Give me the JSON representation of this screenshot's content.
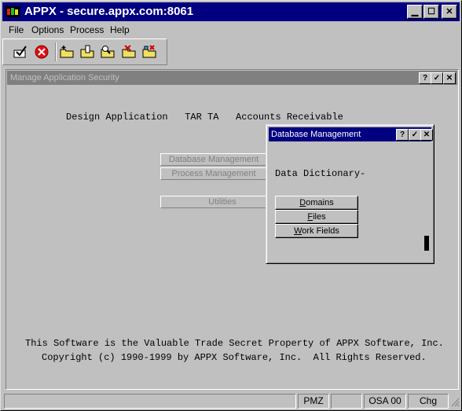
{
  "window": {
    "title": "APPX - secure.appx.com:8061",
    "controls": [
      "minimize",
      "maximize",
      "close"
    ]
  },
  "menu": [
    "File",
    "Options",
    "Process",
    "Help"
  ],
  "toolbar": {
    "icons": [
      "ok-check-icon",
      "cancel-icon",
      "folder-add-icon",
      "folder-edit-icon",
      "folder-search-icon",
      "folder-delete-icon",
      "folder-tools-icon"
    ]
  },
  "mdi": {
    "title": "Manage Application Security",
    "header_line": "Design Application   TAR TA   Accounts Receivable",
    "buttons": [
      "Database Management",
      "Process Management",
      "Utilities"
    ],
    "footer_line1": "This Software is the Valuable Trade Secret Property of APPX Software, Inc.",
    "footer_line2": "Copyright (c) 1990-1999 by APPX Software, Inc.  All Rights Reserved."
  },
  "dialog": {
    "title": "Database Management",
    "label": "Data Dictionary-",
    "buttons": [
      {
        "pre": "",
        "ul": "D",
        "post": "omains"
      },
      {
        "pre": "",
        "ul": "F",
        "post": "iles"
      },
      {
        "pre": "",
        "ul": "W",
        "post": "ork Fields"
      }
    ]
  },
  "status": {
    "panel1": "PMZ",
    "panel2": "",
    "panel3": "OSA 00",
    "panel4": "Chg"
  }
}
